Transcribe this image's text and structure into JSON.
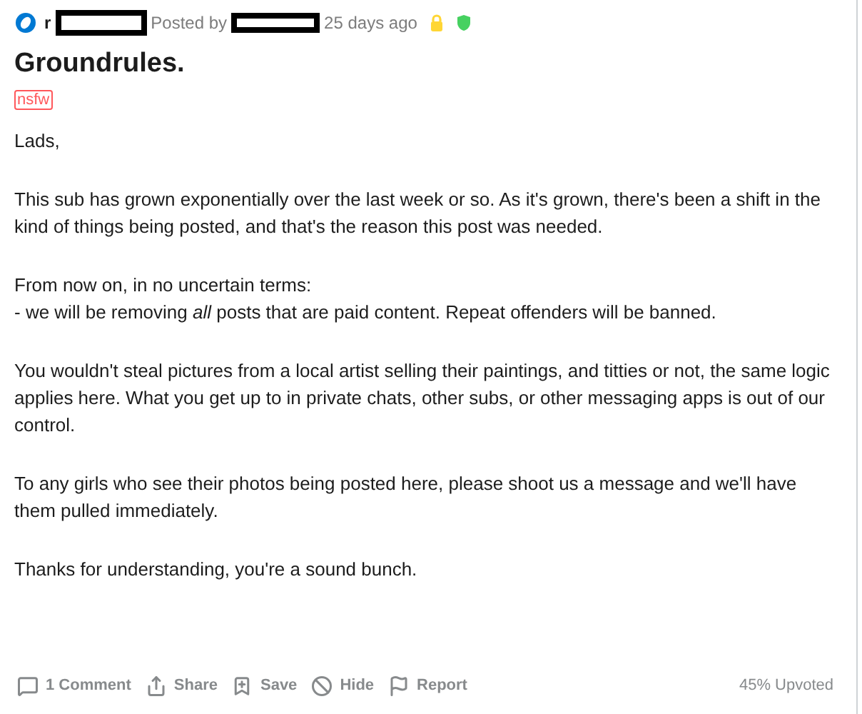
{
  "header": {
    "subreddit_prefix": "r",
    "posted_by": "Posted by",
    "time": "25 days ago"
  },
  "title": "Groundrules.",
  "flair": "nsfw",
  "body": [
    "Lads,",
    "This sub has grown exponentially over the last week or so. As it's grown, there's been a shift in the kind of things being posted, and that's the reason this post was needed.",
    "From now on, in no uncertain terms:\n- we will be removing *all* posts that are paid content. Repeat offenders will be banned.",
    "You wouldn't steal pictures from a local artist selling their paintings, and titties or not, the same logic applies here. What you get up to in private chats, other subs, or other messaging apps is out of our control.",
    "To any girls who see their photos being posted here, please shoot us a message and we'll have them pulled immediately.",
    "Thanks for understanding, you're a sound bunch."
  ],
  "actions": [
    {
      "kind": "comment",
      "label": "1 Comment"
    },
    {
      "kind": "share",
      "label": "Share"
    },
    {
      "kind": "save",
      "label": "Save"
    },
    {
      "kind": "hide",
      "label": "Hide"
    },
    {
      "kind": "report",
      "label": "Report"
    }
  ],
  "upvoted": "45% Upvoted"
}
